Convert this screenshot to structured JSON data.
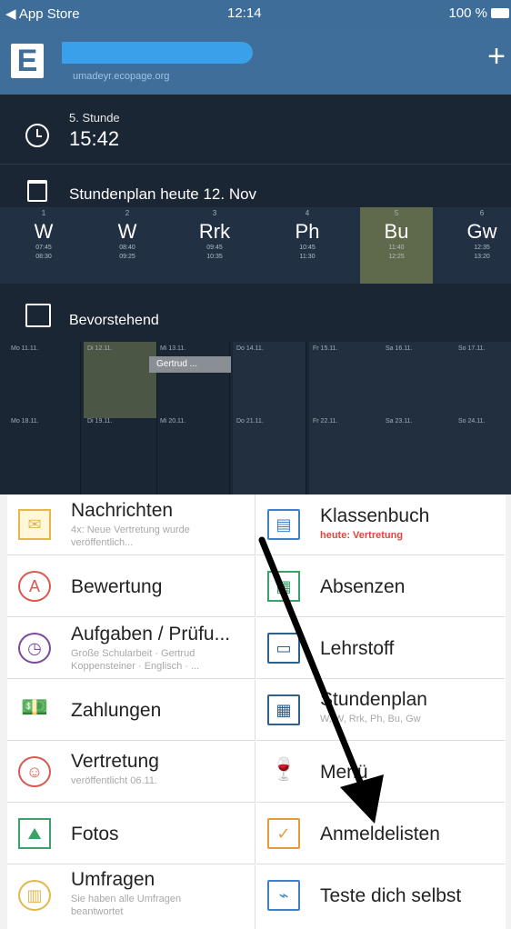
{
  "statusbar": {
    "back": "◀ App Store",
    "time": "12:14",
    "battery": "100 %"
  },
  "header": {
    "logo": "E",
    "add": "+",
    "school_subtitle": "umadeyr.ecopage.org"
  },
  "current_lesson": {
    "number": "5. Stunde",
    "time": "15:42"
  },
  "timetable": {
    "label": "Stundenplan heute 12. Nov",
    "periods": [
      {
        "num": "1",
        "subject": "W",
        "t1": "07:45",
        "t2": "08:30"
      },
      {
        "num": "2",
        "subject": "W",
        "t1": "08:40",
        "t2": "09:25"
      },
      {
        "num": "3",
        "subject": "Rrk",
        "t1": "09:45",
        "t2": "10:35"
      },
      {
        "num": "4",
        "subject": "Ph",
        "t1": "10:45",
        "t2": "11:30"
      },
      {
        "num": "5",
        "subject": "Bu",
        "t1": "11:40",
        "t2": "12:25"
      },
      {
        "num": "6",
        "subject": "Gw",
        "t1": "12:35",
        "t2": "13:20"
      }
    ]
  },
  "upcoming": {
    "label": "Bevorstehend",
    "week1": [
      "Mo 11.11.",
      "Di 12.11.",
      "Mi 13.11.",
      "Do 14.11.",
      "Fr 15.11.",
      "Sa 16.11.",
      "So 17.11."
    ],
    "week2": [
      "Mo 18.11.",
      "Di 19.11.",
      "Mi 20.11.",
      "Do 21.11.",
      "Fr 22.11.",
      "Sa 23.11.",
      "So 24.11."
    ],
    "event": "Gertrud ..."
  },
  "tiles": {
    "nachrichten": {
      "title": "Nachrichten",
      "sub1": "4x: Neue Vertretung wurde",
      "sub2": "veröffentlich..."
    },
    "klassenbuch": {
      "title": "Klassenbuch",
      "sub1": "heute: Vertretung"
    },
    "bewertung": {
      "title": "Bewertung"
    },
    "absenzen": {
      "title": "Absenzen"
    },
    "aufgaben": {
      "title": "Aufgaben / Prüfu...",
      "sub1": "Große Schularbeit · Gertrud",
      "sub2": "Koppensteiner · Englisch · ..."
    },
    "lehrstoff": {
      "title": "Lehrstoff"
    },
    "zahlungen": {
      "title": "Zahlungen"
    },
    "stundenplan": {
      "title": "Stundenplan",
      "sub1": "W, W, Rrk, Ph, Bu, Gw"
    },
    "vertretung": {
      "title": "Vertretung",
      "sub1": "veröffentlicht 06.11."
    },
    "menu": {
      "title": "Menü"
    },
    "fotos": {
      "title": "Fotos"
    },
    "anmeldelisten": {
      "title": "Anmeldelisten"
    },
    "umfragen": {
      "title": "Umfragen",
      "sub1": "Sie haben alle Umfragen",
      "sub2": "beantwortet"
    },
    "teste": {
      "title": "Teste dich selbst"
    }
  },
  "colors": {
    "header": "#3e6e99",
    "dark_bg": "#1b2634",
    "highlight": "#5f6a4c",
    "red": "#e2453c"
  }
}
